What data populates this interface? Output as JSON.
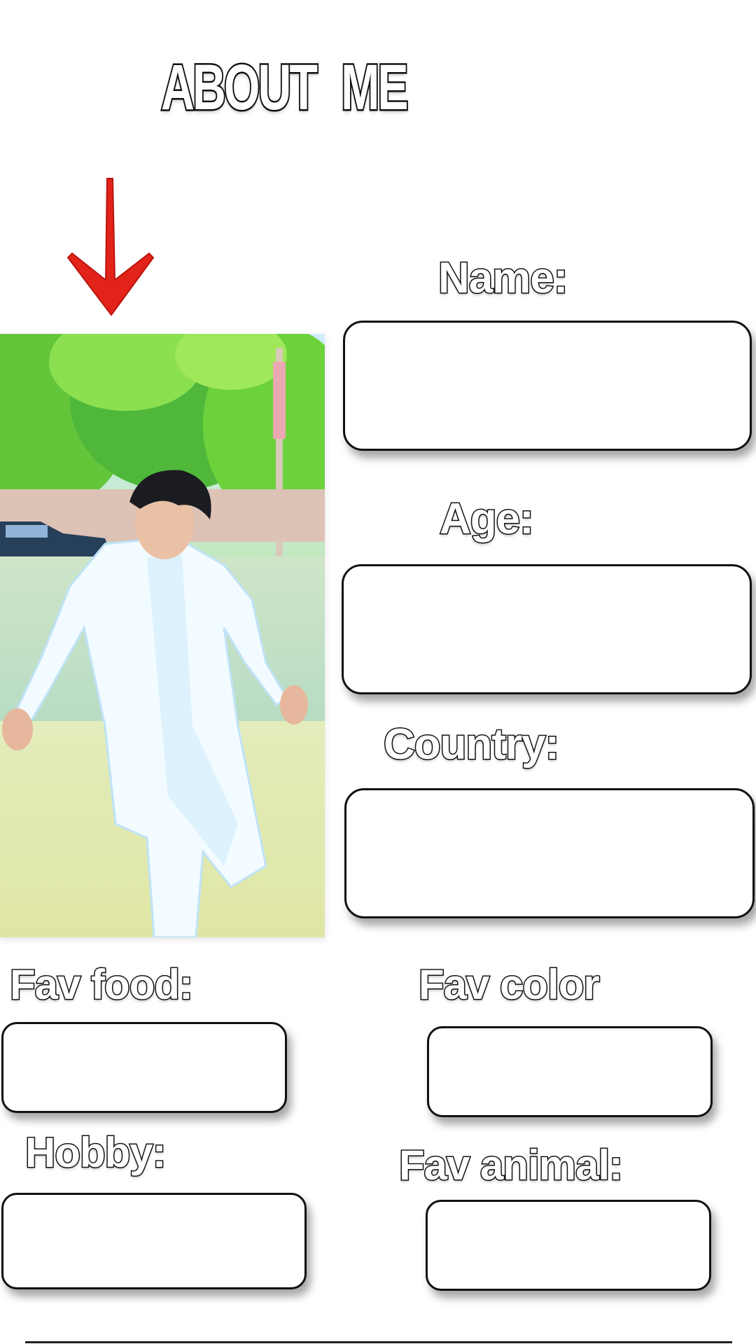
{
  "title": {
    "word1": "ABOUT",
    "word2": "ME"
  },
  "arrow": {
    "icon": "arrow-down-icon",
    "color": "#e2231a"
  },
  "photo": {
    "subject": "profile-photo"
  },
  "fields": {
    "name": {
      "label": "Name:",
      "value": ""
    },
    "age": {
      "label": "Age:",
      "value": ""
    },
    "country": {
      "label": "Country:",
      "value": ""
    },
    "food": {
      "label": "Fav food:",
      "value": ""
    },
    "color": {
      "label": "Fav color",
      "value": ""
    },
    "hobby": {
      "label": "Hobby:",
      "value": ""
    },
    "animal": {
      "label": "Fav animal:",
      "value": ""
    }
  },
  "colors": {
    "background": "#ffffff",
    "outline": "#111111",
    "arrow": "#e2231a"
  }
}
